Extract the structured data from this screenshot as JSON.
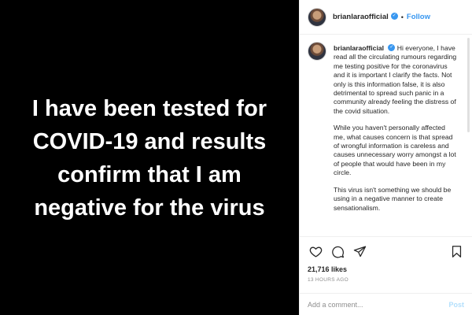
{
  "media": {
    "text": "I have been tested for\nCOVID-19 and results\nconfirm that I am\nnegative for the virus"
  },
  "header": {
    "username": "brianlaraofficial",
    "dot": "•",
    "follow_label": "Follow"
  },
  "caption": {
    "username": "brianlaraofficial",
    "paragraphs": [
      "Hi everyone, I have read all the circulating rumours regarding me testing positive for the coronavirus and it is important I clarify the facts. Not only is this information false, it is also detrimental to spread such panic in a community already feeling the distress of the covid situation.",
      "While you haven't personally affected me, what causes concern is that spread of wrongful information is careless and causes unnecessary worry amongst a lot of people that would have been in my circle.",
      "This virus isn't something we should be using in a negative manner to create sensationalism."
    ]
  },
  "actions": {
    "likes": "21,716 likes",
    "time": "13 HOURS AGO"
  },
  "comment": {
    "placeholder": "Add a comment...",
    "post_label": "Post"
  },
  "colors": {
    "accent": "#3897f0",
    "post_disabled": "#b2dffc",
    "text": "#262626",
    "muted": "#8e8e8e",
    "media_bg": "#000000"
  },
  "icons": [
    "heart-icon",
    "comment-icon",
    "share-icon",
    "bookmark-icon",
    "verified-icon"
  ]
}
